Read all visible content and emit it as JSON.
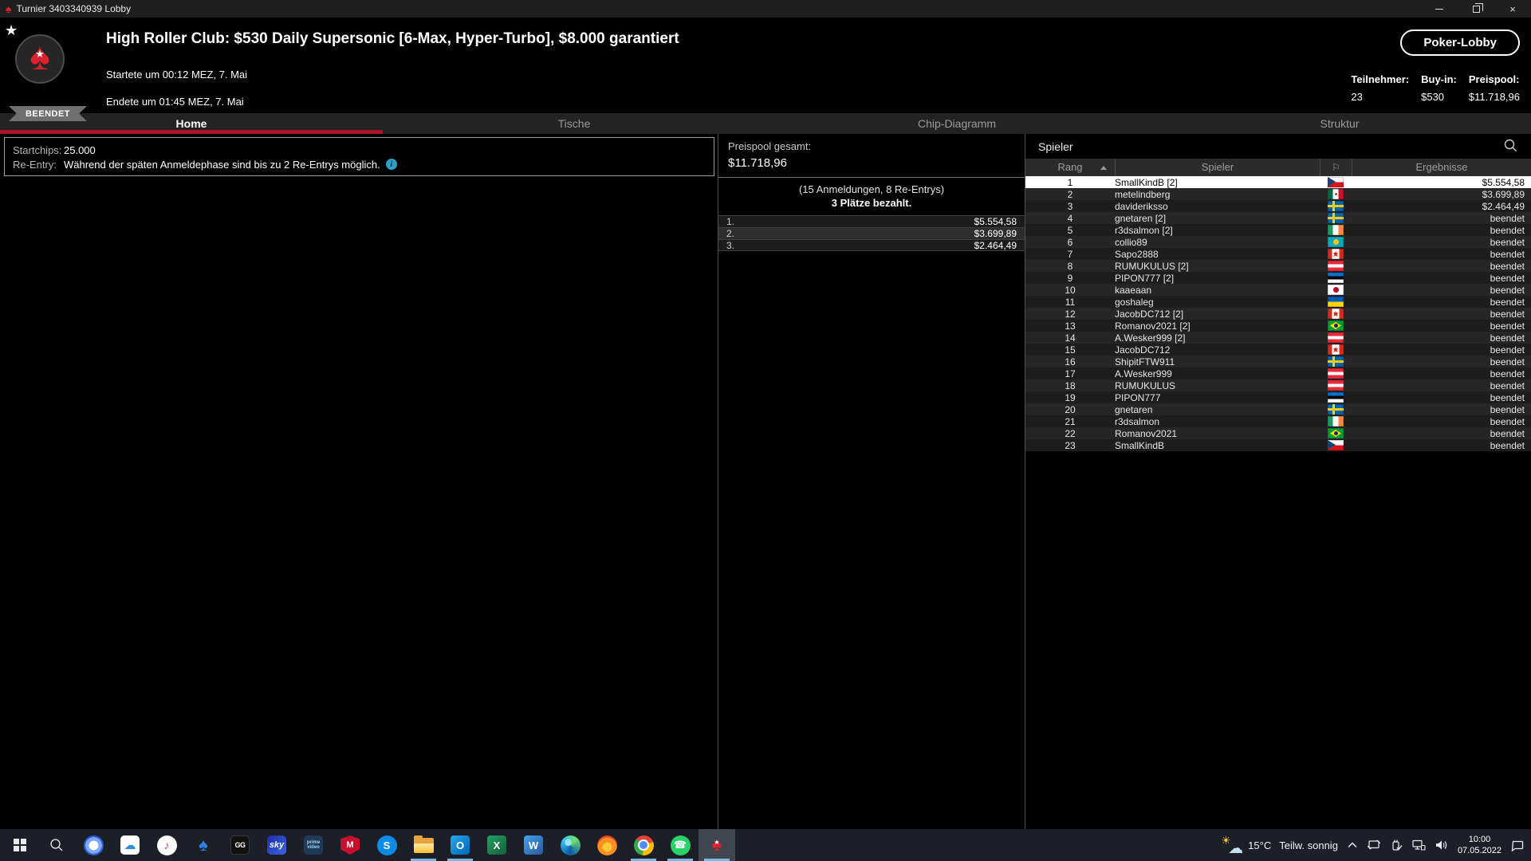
{
  "window": {
    "title": "Turnier 3403340939 Lobby"
  },
  "header": {
    "badge": "BEENDET",
    "title": "High Roller Club: $530 Daily Supersonic [6-Max, Hyper-Turbo], $8.000 garantiert",
    "started": "Startete um 00:12 MEZ, 7. Mai",
    "ended": "Endete um 01:45 MEZ, 7. Mai",
    "lobby_button": "Poker-Lobby",
    "stats": [
      {
        "label": "Teilnehmer:",
        "value": "23"
      },
      {
        "label": "Buy-in:",
        "value": "$530"
      },
      {
        "label": "Preispool:",
        "value": "$11.718,96"
      }
    ]
  },
  "tabs": [
    {
      "label": "Home",
      "active": true
    },
    {
      "label": "Tische"
    },
    {
      "label": "Chip-Diagramm"
    },
    {
      "label": "Struktur"
    }
  ],
  "info_box": {
    "startchips_label": "Startchips:",
    "startchips_value": "25.000",
    "reentry_label": "Re-Entry:",
    "reentry_text": "Während der späten Anmeldephase sind bis zu 2 Re-Entrys möglich."
  },
  "prize_panel": {
    "total_label": "Preispool gesamt:",
    "total_value": "$11.718,96",
    "registrations": "(15 Anmeldungen, 8 Re-Entrys)",
    "places_paid": "3 Plätze bezahlt.",
    "prizes": [
      {
        "place": "1.",
        "amount": "$5.554,58"
      },
      {
        "place": "2.",
        "amount": "$3.699,89"
      },
      {
        "place": "3.",
        "amount": "$2.464,49"
      }
    ]
  },
  "players_panel": {
    "title": "Spieler",
    "header": {
      "rank": "Rang",
      "player": "Spieler",
      "results": "Ergebnisse"
    },
    "rows": [
      {
        "rank": "1",
        "name": "SmallKindB [2]",
        "flag": "cz",
        "result": "$5.554,58",
        "selected": true
      },
      {
        "rank": "2",
        "name": "metelindberg",
        "flag": "mx",
        "result": "$3.699,89"
      },
      {
        "rank": "3",
        "name": "davideriksso",
        "flag": "se",
        "result": "$2.464,49"
      },
      {
        "rank": "4",
        "name": "gnetaren [2]",
        "flag": "se",
        "result": "beendet"
      },
      {
        "rank": "5",
        "name": "r3dsalmon [2]",
        "flag": "ie",
        "result": "beendet"
      },
      {
        "rank": "6",
        "name": "collio89",
        "flag": "kz",
        "result": "beendet"
      },
      {
        "rank": "7",
        "name": "Sapo2888",
        "flag": "ca",
        "result": "beendet"
      },
      {
        "rank": "8",
        "name": "RUMUKULUS [2]",
        "flag": "at",
        "result": "beendet"
      },
      {
        "rank": "9",
        "name": "PIPON777 [2]",
        "flag": "ee",
        "result": "beendet"
      },
      {
        "rank": "10",
        "name": "kaaeaan",
        "flag": "jp",
        "result": "beendet"
      },
      {
        "rank": "11",
        "name": "goshaleg",
        "flag": "ua",
        "result": "beendet"
      },
      {
        "rank": "12",
        "name": "JacobDC712 [2]",
        "flag": "ca",
        "result": "beendet"
      },
      {
        "rank": "13",
        "name": "Romanov2021 [2]",
        "flag": "br",
        "result": "beendet"
      },
      {
        "rank": "14",
        "name": "A.Wesker999 [2]",
        "flag": "at",
        "result": "beendet"
      },
      {
        "rank": "15",
        "name": "JacobDC712",
        "flag": "ca",
        "result": "beendet"
      },
      {
        "rank": "16",
        "name": "ShipitFTW911",
        "flag": "se",
        "result": "beendet"
      },
      {
        "rank": "17",
        "name": "A.Wesker999",
        "flag": "at",
        "result": "beendet"
      },
      {
        "rank": "18",
        "name": "RUMUKULUS",
        "flag": "at",
        "result": "beendet"
      },
      {
        "rank": "19",
        "name": "PIPON777",
        "flag": "ee",
        "result": "beendet"
      },
      {
        "rank": "20",
        "name": "gnetaren",
        "flag": "se",
        "result": "beendet"
      },
      {
        "rank": "21",
        "name": "r3dsalmon",
        "flag": "ie",
        "result": "beendet"
      },
      {
        "rank": "22",
        "name": "Romanov2021",
        "flag": "br",
        "result": "beendet"
      },
      {
        "rank": "23",
        "name": "SmallKindB",
        "flag": "cz",
        "result": "beendet"
      }
    ]
  },
  "taskbar": {
    "apps": [
      {
        "name": "start"
      },
      {
        "name": "search"
      },
      {
        "name": "signal"
      },
      {
        "name": "icloud"
      },
      {
        "name": "apple-music"
      },
      {
        "name": "poker-tracker"
      },
      {
        "name": "ggpoker",
        "glyph": "GG"
      },
      {
        "name": "sky",
        "glyph": "sky"
      },
      {
        "name": "prime-video",
        "glyph": "prime video"
      },
      {
        "name": "mcafee",
        "glyph": "M"
      },
      {
        "name": "skype",
        "glyph": "S"
      },
      {
        "name": "file-explorer",
        "active": true
      },
      {
        "name": "outlook",
        "glyph": "O",
        "active": true
      },
      {
        "name": "excel",
        "glyph": "X"
      },
      {
        "name": "word",
        "glyph": "W"
      },
      {
        "name": "edge"
      },
      {
        "name": "firefox"
      },
      {
        "name": "chrome",
        "active": true
      },
      {
        "name": "whatsapp",
        "active": true
      },
      {
        "name": "pokerstars",
        "active": true,
        "focused": true
      }
    ],
    "weather": {
      "temp": "15°C",
      "condition": "Teilw. sonnig"
    },
    "clock": {
      "time": "10:00",
      "date": "07.05.2022"
    }
  },
  "colors": {
    "accent_red": "#ab1228",
    "pokerstars_red": "#d8232f",
    "taskbar_active_underline": "#76b9ed",
    "info_icon_blue": "#2d9ec6",
    "selected_row_bg": "#ffffff"
  }
}
